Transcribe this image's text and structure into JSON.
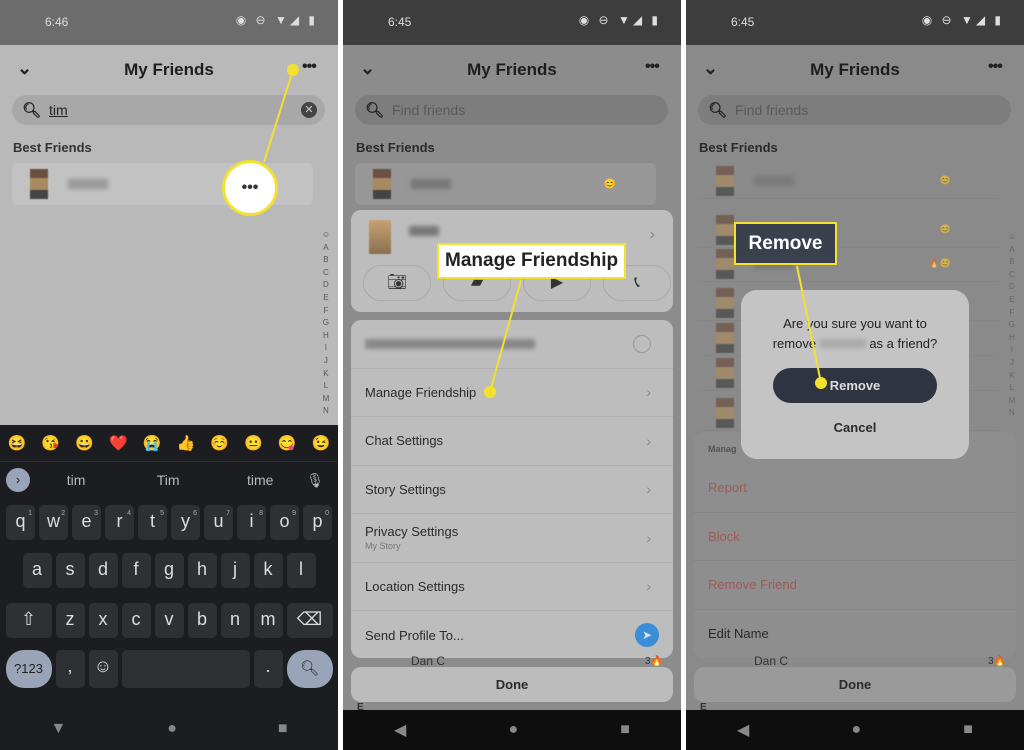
{
  "panels": [
    {
      "status_time": "6:46",
      "title": "My Friends",
      "search_value": "tim",
      "section": "Best Friends",
      "alphabet": [
        "☺",
        "A",
        "B",
        "C",
        "D",
        "E",
        "F",
        "G",
        "H",
        "I",
        "J",
        "K",
        "L",
        "M",
        "N"
      ],
      "keyboard": {
        "emojis": [
          "😆",
          "😘",
          "😀",
          "❤️",
          "😭",
          "👍",
          "☺️",
          "😐",
          "😋",
          "😉"
        ],
        "suggestions": [
          "tim",
          "Tim",
          "time"
        ],
        "row1": [
          "q",
          "w",
          "e",
          "r",
          "t",
          "y",
          "u",
          "i",
          "o",
          "p"
        ],
        "row1_nums": [
          "1",
          "2",
          "3",
          "4",
          "5",
          "6",
          "7",
          "8",
          "9",
          "0"
        ],
        "row2": [
          "a",
          "s",
          "d",
          "f",
          "g",
          "h",
          "j",
          "k",
          "l"
        ],
        "row3": [
          "z",
          "x",
          "c",
          "v",
          "b",
          "n",
          "m"
        ],
        "symbols_key": "?123",
        "comma": ",",
        "period": "."
      }
    },
    {
      "status_time": "6:45",
      "title": "My Friends",
      "search_placeholder": "Find friends",
      "section": "Best Friends",
      "menu": [
        {
          "label": "Manage Friendship"
        },
        {
          "label": "Chat Settings"
        },
        {
          "label": "Story Settings"
        },
        {
          "label": "Privacy Settings",
          "sub": "My Story"
        },
        {
          "label": "Location Settings"
        },
        {
          "label": "Send Profile To..."
        }
      ],
      "behind_friend": "Dan C",
      "behind_streak": "3🔥",
      "section_e": "E",
      "done": "Done",
      "callout": "Manage Friendship"
    },
    {
      "status_time": "6:45",
      "title": "My Friends",
      "search_placeholder": "Find friends",
      "section": "Best Friends",
      "sheet_header": "Manag",
      "sheet": [
        "Report",
        "Block",
        "Remove Friend",
        "Edit Name"
      ],
      "behind_friend": "Dan C",
      "behind_streak": "3🔥",
      "section_e": "E",
      "done": "Done",
      "dialog": {
        "line1": "Are you sure you want to",
        "line2_pre": "remove",
        "line2_post": "as a friend?",
        "confirm": "Remove",
        "cancel": "Cancel"
      },
      "callout": "Remove"
    }
  ],
  "colors": {
    "highlight": "#f2e12e",
    "send_blue": "#3a8ed8",
    "destructive": "#a05a5a"
  }
}
